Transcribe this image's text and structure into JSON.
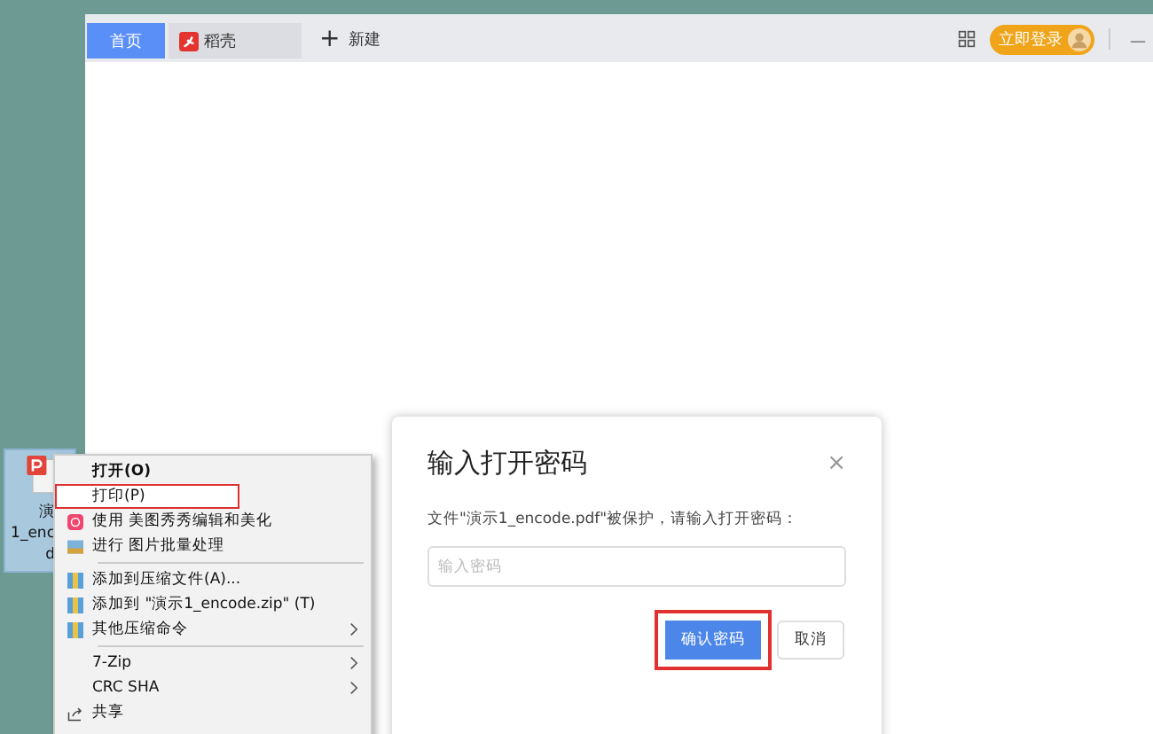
{
  "browser": {
    "tabs": [
      {
        "label": "首页",
        "selected": true
      },
      {
        "label": "稻壳",
        "selected": false
      }
    ],
    "new_tab": {
      "icon": "+",
      "label": "新建"
    },
    "login_button": "立即登录",
    "minimize": "—"
  },
  "desktop_icon": {
    "label_lines": [
      "演",
      "1_enc",
      "d"
    ],
    "selected": true
  },
  "context_menu": {
    "items": [
      {
        "kind": "item",
        "label": "打开(O)",
        "bold": true,
        "submenu": false,
        "annotated": false
      },
      {
        "kind": "item",
        "label": "打印(P)",
        "bold": false,
        "submenu": false,
        "annotated": true
      },
      {
        "kind": "item",
        "label": "使用 美图秀秀编辑和美化",
        "bold": false,
        "submenu": false,
        "annotated": false
      },
      {
        "kind": "item",
        "label": "进行 图片批量处理",
        "bold": false,
        "submenu": false,
        "annotated": false
      },
      {
        "kind": "separator"
      },
      {
        "kind": "item",
        "label": "添加到压缩文件(A)...",
        "bold": false,
        "submenu": false,
        "annotated": false
      },
      {
        "kind": "item",
        "label": "添加到 \"演示1_encode.zip\" (T)",
        "bold": false,
        "submenu": false,
        "annotated": false
      },
      {
        "kind": "item",
        "label": "其他压缩命令",
        "bold": false,
        "submenu": true,
        "annotated": false
      },
      {
        "kind": "separator"
      },
      {
        "kind": "item",
        "label": "7-Zip",
        "bold": false,
        "submenu": true,
        "annotated": false
      },
      {
        "kind": "item",
        "label": "CRC SHA",
        "bold": false,
        "submenu": true,
        "annotated": false
      },
      {
        "kind": "item",
        "label": "共享",
        "bold": false,
        "submenu": false,
        "annotated": false
      }
    ]
  },
  "dialog": {
    "title": "输入打开密码",
    "close": "×",
    "message": "文件\"演示1_encode.pdf\"被保护，请输入打开密码：",
    "password_field": {
      "placeholder": "输入密码"
    },
    "buttons": [
      {
        "label": "确认密码",
        "kind": "primary",
        "annotated": true
      },
      {
        "label": "取消",
        "kind": "default",
        "annotated": false
      }
    ]
  }
}
